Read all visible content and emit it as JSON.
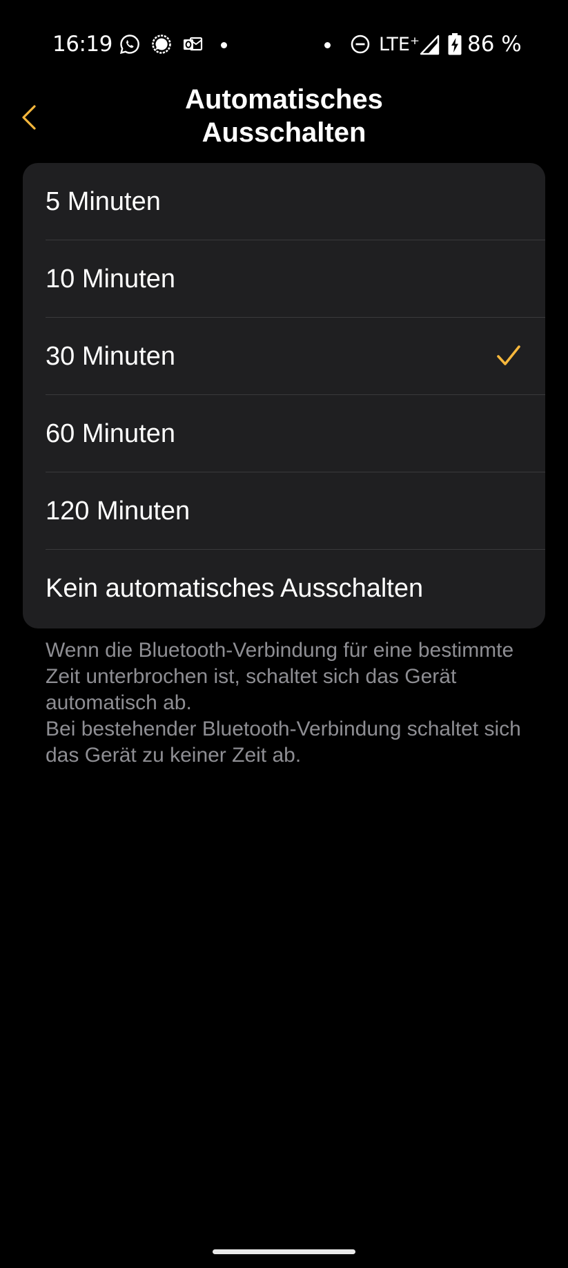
{
  "status_bar": {
    "time": "16:19",
    "network": "LTE⁺",
    "battery": "86 %",
    "icons": [
      "whatsapp-icon",
      "signal-messenger-icon",
      "outlook-icon",
      "do-not-disturb-icon",
      "cell-signal-icon",
      "battery-charging-icon"
    ]
  },
  "header": {
    "title_line1": "Automatisches",
    "title_line2": "Ausschalten",
    "back_icon": "chevron-left-icon"
  },
  "options": [
    {
      "label": "5 Minuten",
      "selected": false
    },
    {
      "label": "10 Minuten",
      "selected": false
    },
    {
      "label": "30 Minuten",
      "selected": true
    },
    {
      "label": "60 Minuten",
      "selected": false
    },
    {
      "label": "120 Minuten",
      "selected": false
    },
    {
      "label": "Kein automatisches Ausschalten",
      "selected": false
    }
  ],
  "description": {
    "line1": "Wenn die Bluetooth-Verbindung für eine bestimmte Zeit unterbrochen ist, schaltet sich das Gerät automatisch ab.",
    "line2": "Bei bestehender Bluetooth-Verbindung schaltet sich das Gerät zu keiner Zeit ab."
  },
  "colors": {
    "accent": "#f6b73c",
    "background": "#000000",
    "card": "#1f1f21",
    "secondary_text": "#8e8e93"
  }
}
